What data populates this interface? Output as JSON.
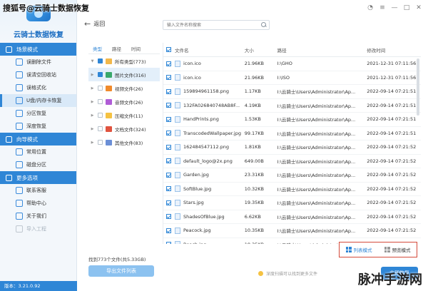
{
  "watermark": {
    "top": "搜狐号@云骑士数据恢复",
    "bottom": "脉冲手游网"
  },
  "app": {
    "logo_text": "云骑士数据恢复",
    "version": "版本：3.21.0.92"
  },
  "sidebar": {
    "sections": [
      {
        "title": "场景模式",
        "items": [
          {
            "label": "误删除文件",
            "active": false,
            "dim": false
          },
          {
            "label": "误清空回收站",
            "active": false,
            "dim": false
          },
          {
            "label": "误格式化",
            "active": false,
            "dim": false
          },
          {
            "label": "U盘/内存卡恢复",
            "active": true,
            "dim": false
          },
          {
            "label": "分区恢复",
            "active": false,
            "dim": false
          },
          {
            "label": "深度恢复",
            "active": false,
            "dim": false
          }
        ]
      },
      {
        "title": "向导模式",
        "items": [
          {
            "label": "常用位置",
            "active": false,
            "dim": false
          },
          {
            "label": "磁盘分区",
            "active": false,
            "dim": false
          }
        ]
      },
      {
        "title": "更多选项",
        "items": [
          {
            "label": "联系客服",
            "active": false,
            "dim": false
          },
          {
            "label": "帮助中心",
            "active": false,
            "dim": false
          },
          {
            "label": "关于我们",
            "active": false,
            "dim": false
          },
          {
            "label": "导入工程",
            "active": false,
            "dim": true
          }
        ]
      }
    ]
  },
  "toolbar": {
    "back_label": "返回",
    "search_placeholder": "输入文件名称搜索"
  },
  "categories": {
    "tabs": [
      "类型",
      "路径",
      "时间"
    ],
    "items": [
      {
        "label": "所有类型(773)",
        "color": "#f2b84b",
        "checked": true,
        "selected": false
      },
      {
        "label": "图片文件(316)",
        "color": "#39a86b",
        "checked": true,
        "selected": true
      },
      {
        "label": "视频文件(26)",
        "color": "#f08a2b",
        "checked": false,
        "selected": false
      },
      {
        "label": "音频文件(26)",
        "color": "#b05cd6",
        "checked": false,
        "selected": false
      },
      {
        "label": "压缩文件(11)",
        "color": "#f5c242",
        "checked": false,
        "selected": false
      },
      {
        "label": "文档文件(324)",
        "color": "#e0533f",
        "checked": false,
        "selected": false
      },
      {
        "label": "其他文件(83)",
        "color": "#6b8fd6",
        "checked": false,
        "selected": false
      }
    ]
  },
  "table": {
    "headers": {
      "name": "文件名",
      "size": "大小",
      "path": "路径",
      "date": "修改时间"
    },
    "rows": [
      {
        "name": "icon.ico",
        "size": "21.96KB",
        "path": "I:\\GHO",
        "date": "2021-12-31 07:11:56"
      },
      {
        "name": "icon.ico",
        "size": "21.96KB",
        "path": "I:\\ISO",
        "date": "2021-12-31 07:11:56"
      },
      {
        "name": "159894961158.png",
        "size": "1.17KB",
        "path": "I:\\云骑士\\Users\\Administrator\\Ap...",
        "date": "2022-09-14 07:21:51"
      },
      {
        "name": "132FA026840748AB8F...",
        "size": "4.19KB",
        "path": "I:\\云骑士\\Users\\Administrator\\Ap...",
        "date": "2022-09-14 07:21:51"
      },
      {
        "name": "HandPrints.png",
        "size": "1.53KB",
        "path": "I:\\云骑士\\Users\\Administrator\\Ap...",
        "date": "2022-09-14 07:21:51"
      },
      {
        "name": "TranscodedWallpaper.jpg",
        "size": "99.17KB",
        "path": "I:\\云骑士\\Users\\Administrator\\Ap...",
        "date": "2022-09-14 07:21:51"
      },
      {
        "name": "162484547112.png",
        "size": "1.81KB",
        "path": "I:\\云骑士\\Users\\Administrator\\Ap...",
        "date": "2022-09-14 07:21:52"
      },
      {
        "name": "default_logo@2x.png",
        "size": "649.00B",
        "path": "I:\\云骑士\\Users\\Administrator\\Ap...",
        "date": "2022-09-14 07:21:52"
      },
      {
        "name": "Garden.jpg",
        "size": "23.31KB",
        "path": "I:\\云骑士\\Users\\Administrator\\Ap...",
        "date": "2022-09-14 07:21:52"
      },
      {
        "name": "SoftBlue.jpg",
        "size": "10.32KB",
        "path": "I:\\云骑士\\Users\\Administrator\\Ap...",
        "date": "2022-09-14 07:21:52"
      },
      {
        "name": "Stars.jpg",
        "size": "19.35KB",
        "path": "I:\\云骑士\\Users\\Administrator\\Ap...",
        "date": "2022-09-14 07:21:52"
      },
      {
        "name": "ShadesOfBlue.jpg",
        "size": "6.62KB",
        "path": "I:\\云骑士\\Users\\Administrator\\Ap...",
        "date": "2022-09-14 07:21:52"
      },
      {
        "name": "Peacock.jpg",
        "size": "10.35KB",
        "path": "I:\\云骑士\\Users\\Administrator\\Ap...",
        "date": "2022-09-14 07:21:52"
      },
      {
        "name": "Beach.jpg",
        "size": "18.35KB",
        "path": "I:\\云骑士\\Users\\Administrator\\Ap...",
        "date": "2022-09-14 07:21:52"
      }
    ]
  },
  "footer": {
    "found_text": "找到773个文件(共5.33GB)",
    "export_label": "导出文件列表",
    "hint": "深度扫描可以找到更多文件",
    "recover_label": "立即恢复",
    "view_list": "列表模式",
    "view_preview": "预览模式"
  }
}
